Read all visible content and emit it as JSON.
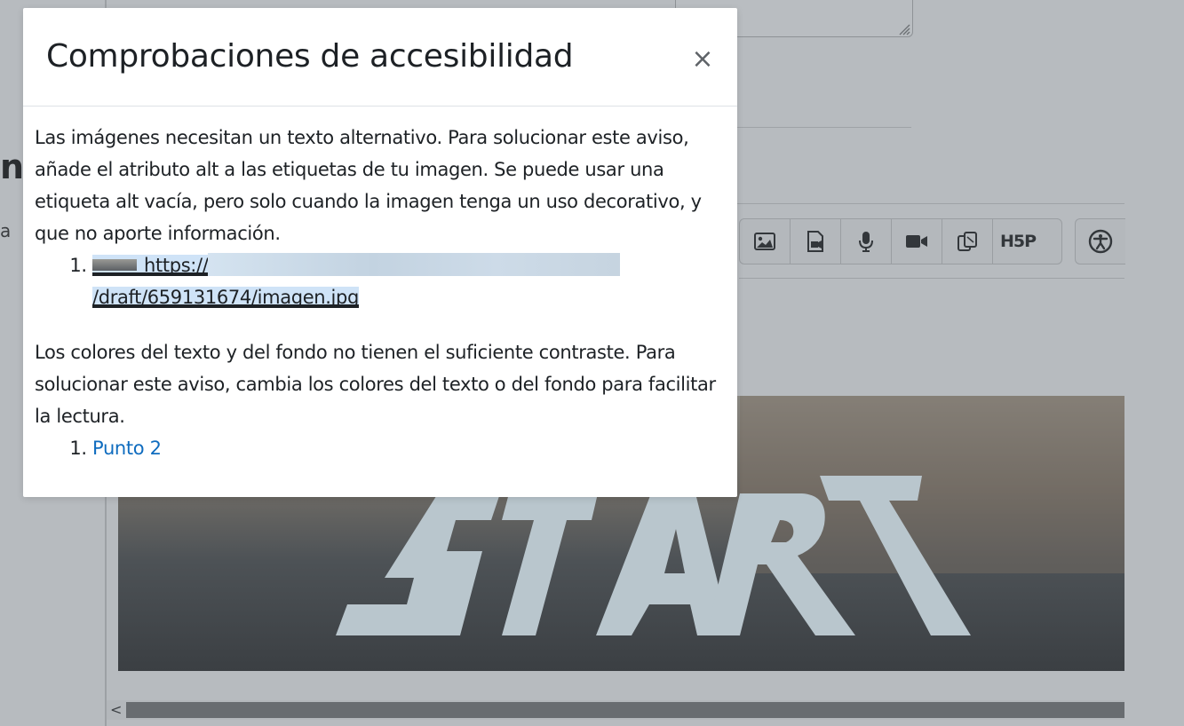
{
  "background": {
    "heading_fragment": "ni",
    "small_fragment": "a",
    "toolbar": {
      "buttons": [
        {
          "icon": "image-icon"
        },
        {
          "icon": "media-icon"
        },
        {
          "icon": "microphone-icon"
        },
        {
          "icon": "video-camera-icon"
        },
        {
          "icon": "copy-icon"
        },
        {
          "icon": "h5p-icon",
          "label": "H5P"
        }
      ],
      "accessibility_button": {
        "icon": "accessibility-icon"
      }
    },
    "image": {
      "text": "START"
    },
    "scrollbar": {
      "left_arrow": "<"
    }
  },
  "modal": {
    "title": "Comprobaciones de accesibilidad",
    "close_label": "×",
    "issues": [
      {
        "message": "Las imágenes necesitan un texto alternativo. Para solucionar este aviso, añade el atributo alt a las etiquetas de tu imagen. Se puede usar una etiqueta alt vacía, pero solo cuando la imagen tenga un uso decorativo, y que no aporte información.",
        "items": [
          {
            "url_start": "https://",
            "url_end": "/draft/659131674/imagen.jpg"
          }
        ]
      },
      {
        "message": "Los colores del texto y del fondo no tienen el suficiente contraste. Para solucionar este aviso, cambia los colores del texto o del fondo para facilitar la lectura.",
        "items": [
          {
            "label": "Punto 2"
          }
        ]
      }
    ]
  },
  "colors": {
    "overlay_background": "#b7bbbf",
    "link": "#0f6cbf",
    "text": "#1d2125",
    "selection_highlight": "#cfe3f7"
  }
}
